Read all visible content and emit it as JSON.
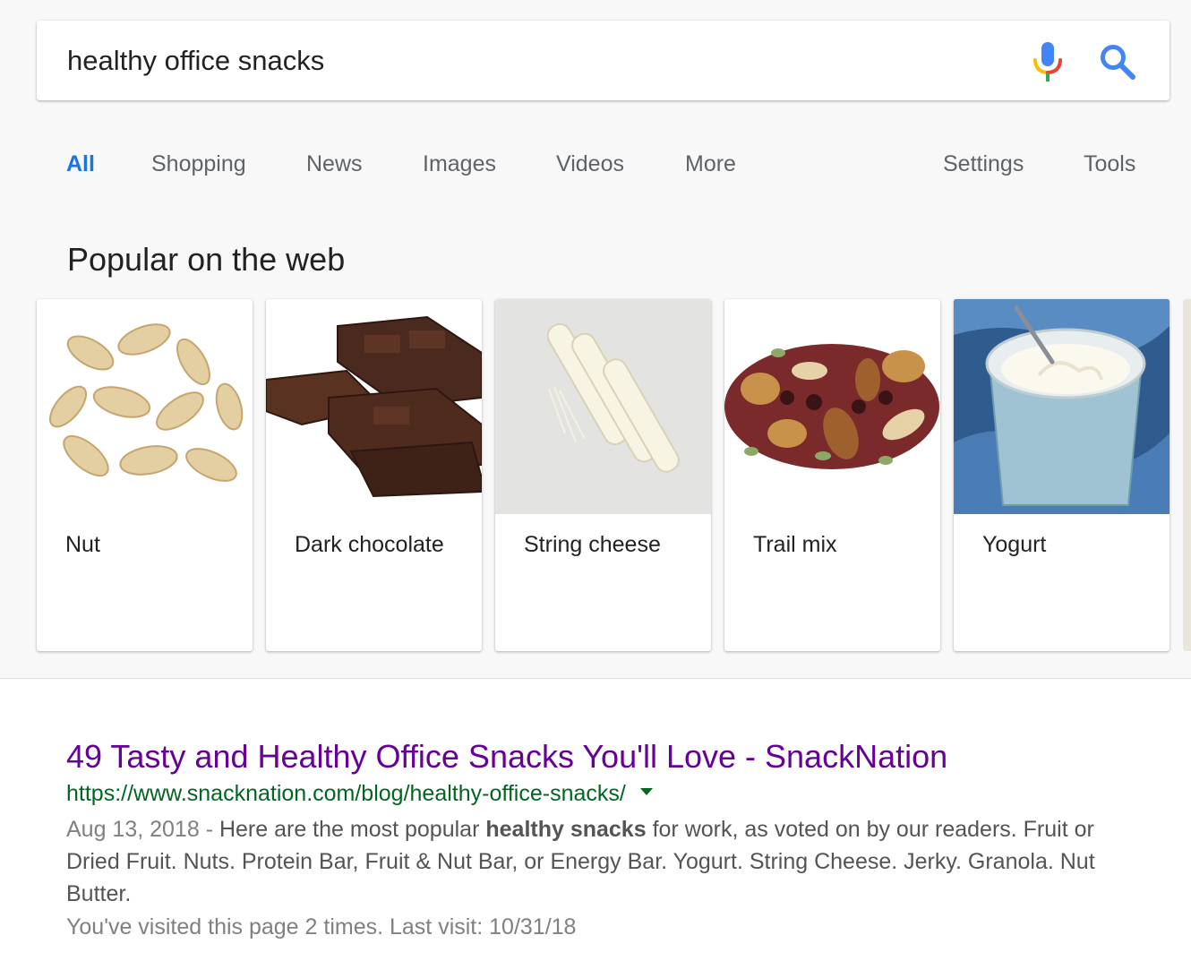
{
  "search": {
    "query": "healthy office snacks"
  },
  "tabs": [
    {
      "label": "All",
      "active": true
    },
    {
      "label": "Shopping"
    },
    {
      "label": "News"
    },
    {
      "label": "Images"
    },
    {
      "label": "Videos"
    },
    {
      "label": "More"
    }
  ],
  "tools": [
    {
      "label": "Settings"
    },
    {
      "label": "Tools"
    }
  ],
  "popular": {
    "title": "Popular on the web",
    "cards": [
      {
        "label": "Nut",
        "image": "cashew-nuts-image"
      },
      {
        "label": "Dark chocolate",
        "image": "dark-chocolate-image"
      },
      {
        "label": "String cheese",
        "image": "string-cheese-image"
      },
      {
        "label": "Trail mix",
        "image": "trail-mix-image"
      },
      {
        "label": "Yogurt",
        "image": "yogurt-cup-image"
      }
    ]
  },
  "result": {
    "title": "49 Tasty and Healthy Office Snacks You'll Love - SnackNation",
    "url": "https://www.snacknation.com/blog/healthy-office-snacks/",
    "date": "Aug 13, 2018",
    "date_separator": " - ",
    "snippet_part1": "Here are the most popular ",
    "snippet_bold": "healthy snacks",
    "snippet_part2": " for work, as voted on by our readers. Fruit or Dried Fruit. Nuts. Protein Bar, Fruit & Nut Bar, or Energy Bar. Yogurt. String Cheese. Jerky. Granola. Nut Butter.",
    "visited": "You've visited this page 2 times. Last visit: 10/31/18"
  },
  "colors": {
    "active_tab": "#1a73e8",
    "visited_link": "#660099",
    "url_green": "#006621",
    "mic_blue": "#4285f4",
    "mic_red": "#ea4335",
    "mic_yellow": "#fbbc05",
    "mic_green": "#34a853"
  }
}
